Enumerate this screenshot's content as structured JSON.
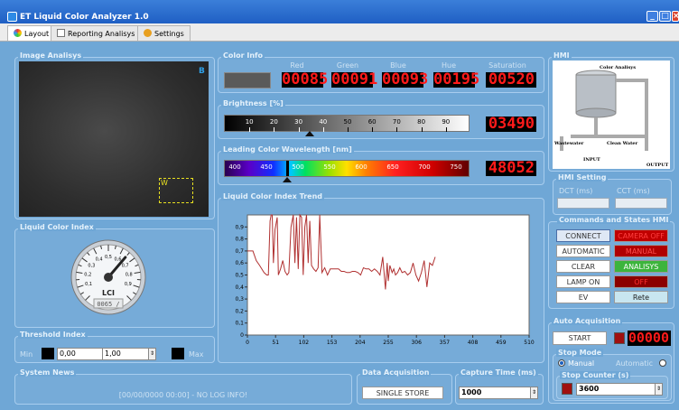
{
  "window": {
    "title": "ET Liquid Color Analyzer 1.0"
  },
  "tabs": [
    {
      "label": "Layout"
    },
    {
      "label": "Reporting Analisys"
    },
    {
      "label": "Settings"
    }
  ],
  "image_analysis": {
    "label": "Image Analisys",
    "marker_b": "B",
    "marker_w": "W"
  },
  "color_info": {
    "label": "Color Info",
    "columns": [
      "Red",
      "Green",
      "Blue",
      "Hue",
      "Saturation"
    ],
    "values": [
      "00085",
      "00091",
      "00093",
      "00195",
      "00520"
    ]
  },
  "brightness": {
    "label": "Brightness [%]",
    "ticks": [
      "10",
      "20",
      "30",
      "40",
      "50",
      "60",
      "70",
      "80",
      "90"
    ],
    "value": "03490",
    "level": 0.349
  },
  "wavelength": {
    "label": "Leading Color Wavelength [nm]",
    "ticks": [
      "400",
      "450",
      "500",
      "550",
      "600",
      "650",
      "700",
      "750"
    ],
    "value": "48052"
  },
  "lci": {
    "label": "Liquid Color Index",
    "gauge_label": "LCI",
    "gauge_value": "0065 /",
    "dial_ticks": [
      "0,1",
      "0,2",
      "0,3",
      "0,4",
      "0,5",
      "0,6",
      "0,7",
      "0,8",
      "0,9"
    ],
    "needle": 0.65
  },
  "threshold": {
    "label": "Threshold Index",
    "min_label": "Min",
    "min_value": "0,00",
    "max_value": "1,00",
    "max_label": "Max"
  },
  "system_news": {
    "label": "System News",
    "text": "[00/00/0000 00:00] - NO LOG INFO!"
  },
  "data_acquisition": {
    "label": "Data Acquisition",
    "button": "SINGLE STORE"
  },
  "capture_time": {
    "label": "Capture Time (ms)",
    "value": "1000"
  },
  "trend": {
    "label": "Liquid Color Index Trend"
  },
  "chart_data": {
    "type": "line",
    "yticks": [
      "0",
      "0,1",
      "0,2",
      "0,3",
      "0,4",
      "0,5",
      "0,6",
      "0,7",
      "0,8",
      "0,9"
    ],
    "xticks": [
      "0",
      "51",
      "102",
      "153",
      "204",
      "255",
      "306",
      "357",
      "408",
      "459",
      "510"
    ],
    "xlim": [
      0,
      510
    ],
    "ylim": [
      0,
      1
    ],
    "x": [
      0,
      10,
      16,
      22,
      26,
      30,
      35,
      38,
      41,
      43,
      45,
      47,
      50,
      54,
      56,
      60,
      64,
      68,
      72,
      75,
      79,
      83,
      86,
      89,
      92,
      95,
      98,
      101,
      104,
      107,
      110,
      113,
      116,
      120,
      124,
      128,
      131,
      135,
      140,
      145,
      150,
      155,
      160,
      165,
      170,
      175,
      180,
      185,
      190,
      195,
      200,
      205,
      210,
      215,
      220,
      225,
      230,
      235,
      240,
      245,
      250,
      253,
      255,
      258,
      262,
      265,
      268,
      272,
      276,
      280,
      285,
      290,
      295,
      300,
      305,
      310,
      315,
      320,
      325,
      330,
      335,
      340
    ],
    "y": [
      0.7,
      0.7,
      0.62,
      0.58,
      0.55,
      0.52,
      0.5,
      0.5,
      0.95,
      1.0,
      1.0,
      0.6,
      0.88,
      0.98,
      0.5,
      0.55,
      0.62,
      0.53,
      0.5,
      0.52,
      0.9,
      1.0,
      0.6,
      0.98,
      0.55,
      1.0,
      0.98,
      0.5,
      0.9,
      1.0,
      0.6,
      0.95,
      0.58,
      0.55,
      0.53,
      0.56,
      1.0,
      0.52,
      0.56,
      0.5,
      0.55,
      0.55,
      0.55,
      0.55,
      0.53,
      0.53,
      0.52,
      0.52,
      0.53,
      0.53,
      0.52,
      0.5,
      0.56,
      0.55,
      0.55,
      0.53,
      0.55,
      0.53,
      0.5,
      0.65,
      0.38,
      0.6,
      0.45,
      0.58,
      0.52,
      0.55,
      0.5,
      0.52,
      0.56,
      0.52,
      0.53,
      0.5,
      0.52,
      0.6,
      0.5,
      0.45,
      0.52,
      0.62,
      0.4,
      0.6,
      0.58,
      0.65
    ]
  },
  "hmi": {
    "label": "HMI",
    "diagram_title": "Color Analisys",
    "wastewater": "Wastewater",
    "clean_water": "Clean Water",
    "input": "INPUT",
    "output": "OUTPUT"
  },
  "hmi_setting": {
    "label": "HMI Setting",
    "dct": "DCT (ms)",
    "cct": "CCT (ms)"
  },
  "commands": {
    "label": "Commands  and States HMI",
    "rows": [
      {
        "cmd": "CONNECT",
        "state": "CAMERA OFF",
        "state_color": "#c00000",
        "state_text": "#ff4040"
      },
      {
        "cmd": "AUTOMATIC",
        "state": "MANUAL",
        "state_color": "#b00000",
        "state_text": "#ff5050"
      },
      {
        "cmd": "CLEAR",
        "state": "ANALISYS",
        "state_color": "#3cb43c",
        "state_text": "#ffffff"
      },
      {
        "cmd": "LAMP ON",
        "state": "OFF",
        "state_color": "#8b0000",
        "state_text": "#ff3030"
      },
      {
        "cmd": "EV",
        "state": "Rete",
        "state_color": "#c8e6f0",
        "state_text": "#222222"
      }
    ]
  },
  "auto_acq": {
    "label": "Auto Acquisition",
    "start": "START",
    "counter": "00000"
  },
  "stop_mode": {
    "label": "Stop Mode",
    "manual": "Manual",
    "automatic": "Automatic"
  },
  "stop_counter": {
    "label": "Stop Counter (s)",
    "value": "3600"
  }
}
